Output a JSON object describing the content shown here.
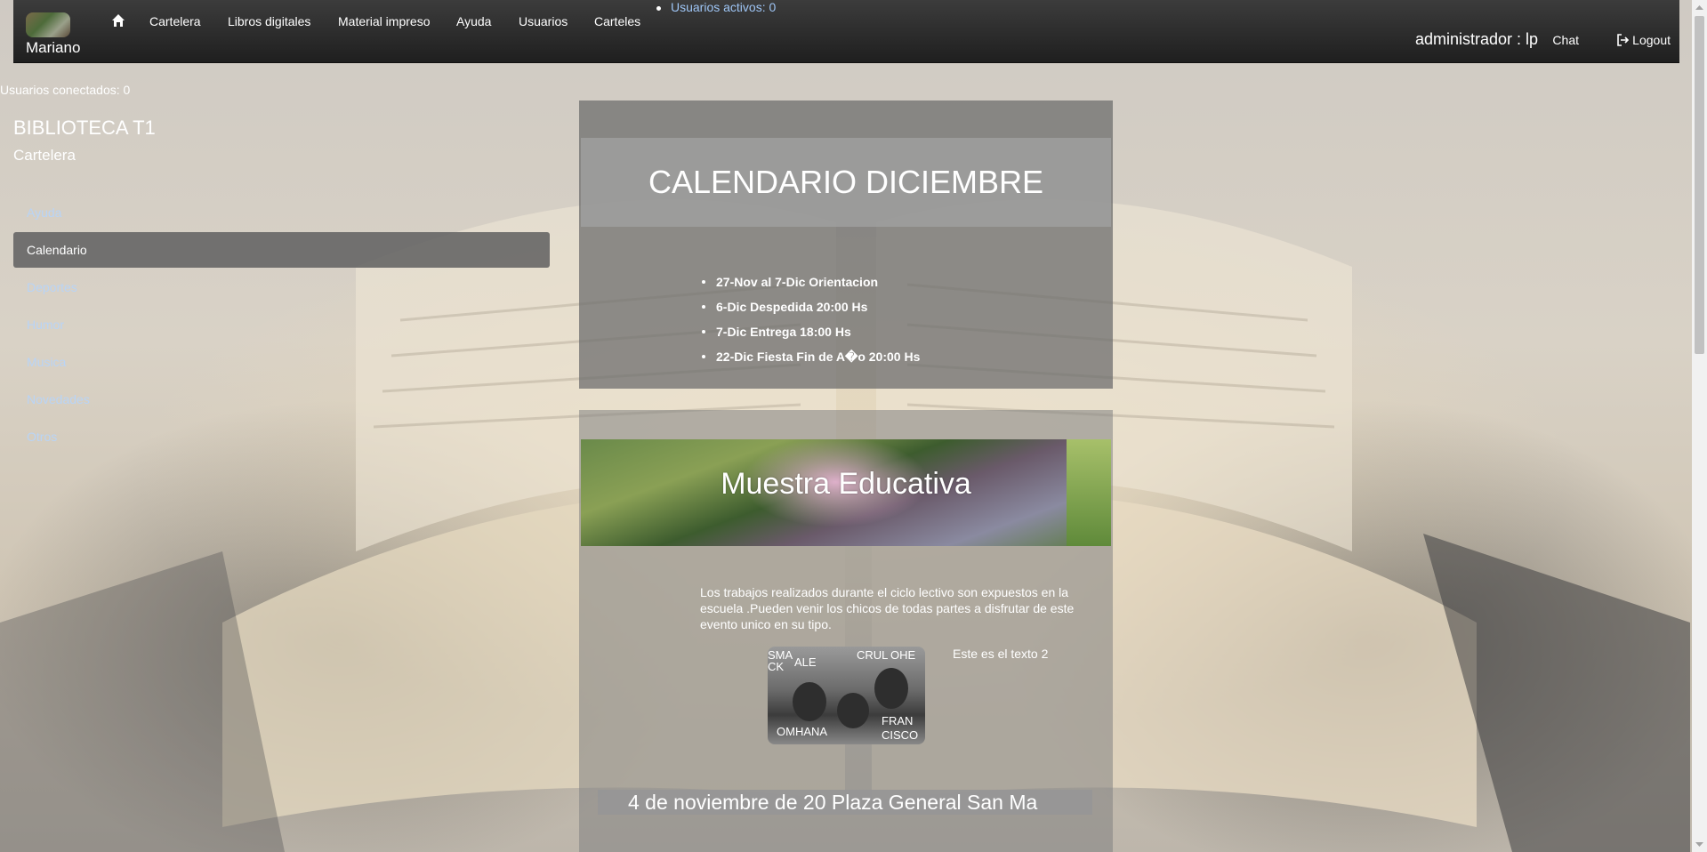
{
  "brand": {
    "name": "Mariano"
  },
  "nav": {
    "items": [
      "Cartelera",
      "Libros digitales",
      "Material impreso",
      "Ayuda",
      "Usuarios",
      "Carteles"
    ],
    "active_users": "Usuarios activos: 0",
    "user": "administrador : lp",
    "chat": "Chat",
    "logout": "Logout"
  },
  "connected_users": "Usuarios conectados: 0",
  "sidebar": {
    "title": "BIBLIOTECA T1",
    "subtitle": "Cartelera",
    "items": [
      {
        "label": "Ayuda",
        "active": false
      },
      {
        "label": "Calendario",
        "active": true
      },
      {
        "label": "Deportes",
        "active": false
      },
      {
        "label": "Humor",
        "active": false
      },
      {
        "label": "Musica",
        "active": false
      },
      {
        "label": "Novedades",
        "active": false
      },
      {
        "label": "Otros",
        "active": false
      }
    ]
  },
  "calendar": {
    "title": "CALENDARIO DICIEMBRE",
    "events": [
      "27-Nov al 7-Dic Orientacion",
      "6-Dic Despedida 20:00 Hs",
      "7-Dic Entrega 18:00 Hs",
      "22-Dic Fiesta Fin de A�o 20:00 Hs"
    ]
  },
  "muestra": {
    "title": "Muestra Educativa",
    "text": "Los trabajos realizados durante el ciclo lectivo son expuestos en la escuela .Pueden venir los chicos de todas partes a disfrutar de este evento unico en su tipo.",
    "photo_labels": [
      "SMA",
      "CK",
      "ALE",
      "CRUL",
      "OHE",
      "OMHANA",
      "FRAN",
      "CISCO"
    ],
    "text2": "Este es el texto 2",
    "ticker": "4 de noviembre de 20 Plaza General San Ma"
  }
}
